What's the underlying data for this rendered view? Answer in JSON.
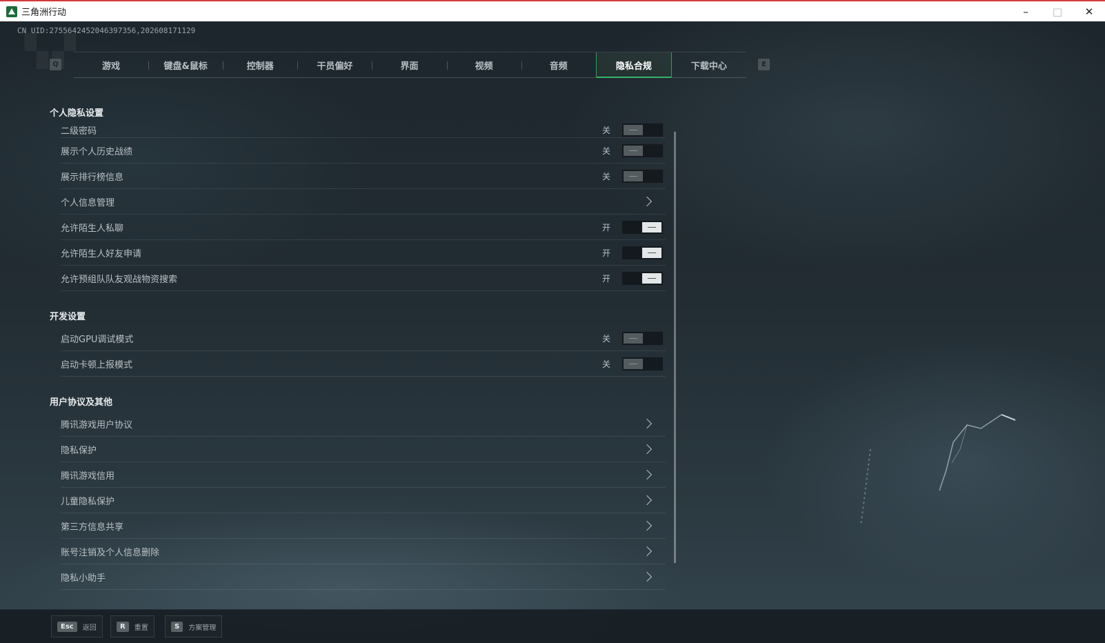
{
  "window": {
    "title": "三角洲行动",
    "minimize": "–",
    "maximize": "□",
    "close": "✕"
  },
  "uid": "CN UID:2755642452046397356,202608171129",
  "tabs": {
    "left_key": "Q",
    "right_key": "E",
    "items": [
      "游戏",
      "键盘&鼠标",
      "控制器",
      "干员偏好",
      "界面",
      "视频",
      "音频",
      "隐私合规",
      "下载中心"
    ],
    "active_index": 7
  },
  "sections": {
    "privacy": {
      "title": "个人隐私设置",
      "rows": [
        {
          "label": "二级密码",
          "state": "关"
        },
        {
          "label": "展示个人历史战绩",
          "state": "关"
        },
        {
          "label": "展示排行榜信息",
          "state": "关"
        },
        {
          "label": "个人信息管理"
        },
        {
          "label": "允许陌生人私聊",
          "state": "开"
        },
        {
          "label": "允许陌生人好友申请",
          "state": "开"
        },
        {
          "label": "允许预组队队友观战物资搜索",
          "state": "开"
        }
      ]
    },
    "dev": {
      "title": "开发设置",
      "rows": [
        {
          "label": "启动GPU调试模式",
          "state": "关"
        },
        {
          "label": "启动卡顿上报模式",
          "state": "关"
        }
      ]
    },
    "agreements": {
      "title": "用户协议及其他",
      "rows": [
        {
          "label": "腾讯游戏用户协议"
        },
        {
          "label": "隐私保护"
        },
        {
          "label": "腾讯游戏信用"
        },
        {
          "label": "儿童隐私保护"
        },
        {
          "label": "第三方信息共享"
        },
        {
          "label": "账号注销及个人信息删除"
        },
        {
          "label": "隐私小助手"
        }
      ]
    }
  },
  "bottom": {
    "back": {
      "key": "Esc",
      "label": "返回"
    },
    "reset": {
      "key": "R",
      "label": "重置"
    },
    "presets": {
      "key": "S",
      "label": "方案管理"
    }
  },
  "colors": {
    "accent": "#3bb26a",
    "toggle_on": "#e4e7e8",
    "toggle_off": "#545c60"
  }
}
